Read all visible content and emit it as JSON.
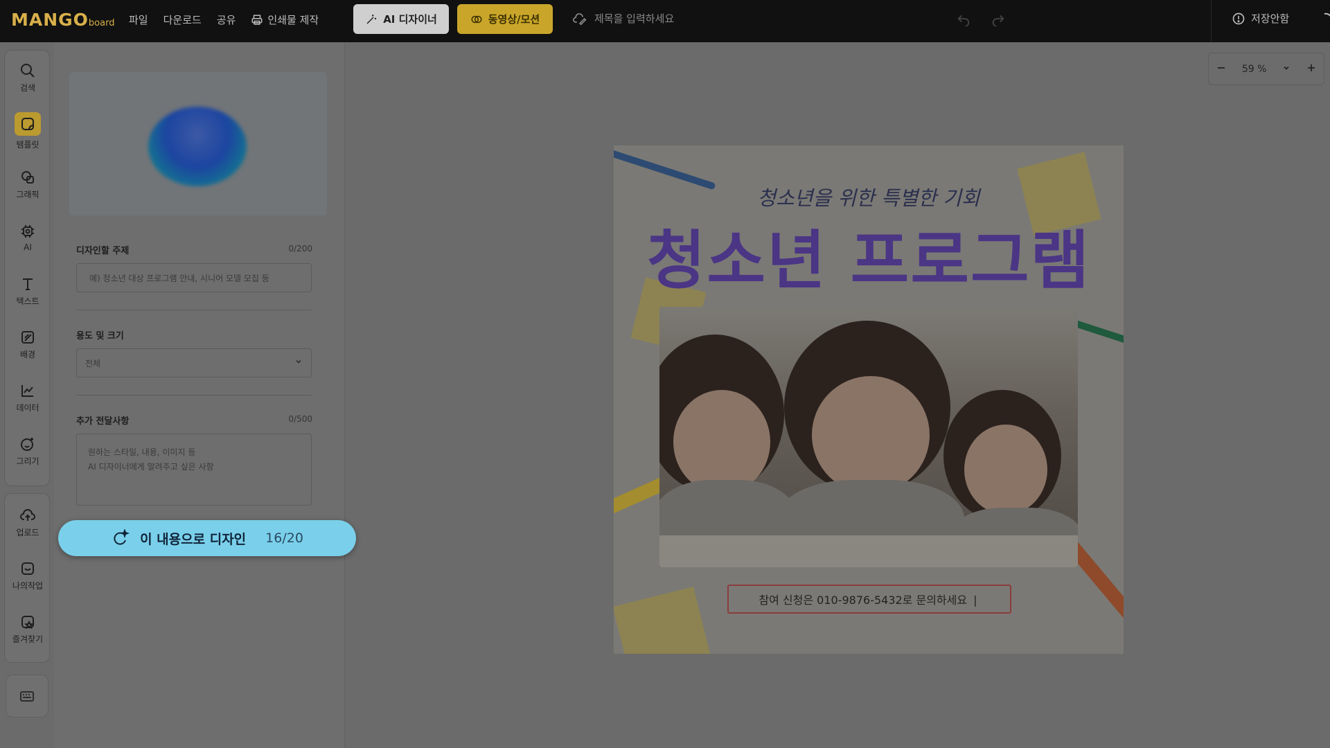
{
  "topbar": {
    "logo_main": "MANGO",
    "logo_sub": "board",
    "menu": [
      {
        "label": "파일"
      },
      {
        "label": "다운로드"
      },
      {
        "label": "공유"
      },
      {
        "label": "인쇄물 제작"
      }
    ],
    "ai_designer_label": "AI 디자이너",
    "video_motion_label": "동영상/모션",
    "title_placeholder": "제목을 입력하세요",
    "save_status": "저장안함"
  },
  "rail": {
    "items": [
      {
        "label": "검색"
      },
      {
        "label": "템플릿"
      },
      {
        "label": "그래픽"
      },
      {
        "label": "AI"
      },
      {
        "label": "텍스트"
      },
      {
        "label": "배경"
      },
      {
        "label": "데이터"
      },
      {
        "label": "그리기"
      }
    ],
    "items2": [
      {
        "label": "업로드"
      },
      {
        "label": "나의작업"
      },
      {
        "label": "즐겨찾기"
      }
    ]
  },
  "panel": {
    "topic_label": "디자인할 주제",
    "topic_count": "0/200",
    "topic_placeholder": "예) 청소년 대상 프로그램 안내, 시니어 모델 모집 등",
    "size_label": "용도 및 크기",
    "size_value": "전체",
    "extra_label": "추가 전달사항",
    "extra_count": "0/500",
    "extra_placeholder_line1": "원하는 스타일, 내용, 이미지 등",
    "extra_placeholder_line2": "AI 디자이너에게 알려주고 싶은 사항",
    "design_button_label": "이 내용으로 디자인",
    "design_button_quota": "16/20"
  },
  "canvas": {
    "zoom_value": "59 %",
    "poster": {
      "subtitle": "청소년을 위한 특별한 기회",
      "headline": "청소년 프로그램",
      "contact": "참여 신청은 010-9876-5432로 문의하세요 ❘"
    }
  },
  "colors": {
    "accent_video": "#c9a62a",
    "design_button": "#7ad0ea",
    "headline": "#4b3585"
  }
}
